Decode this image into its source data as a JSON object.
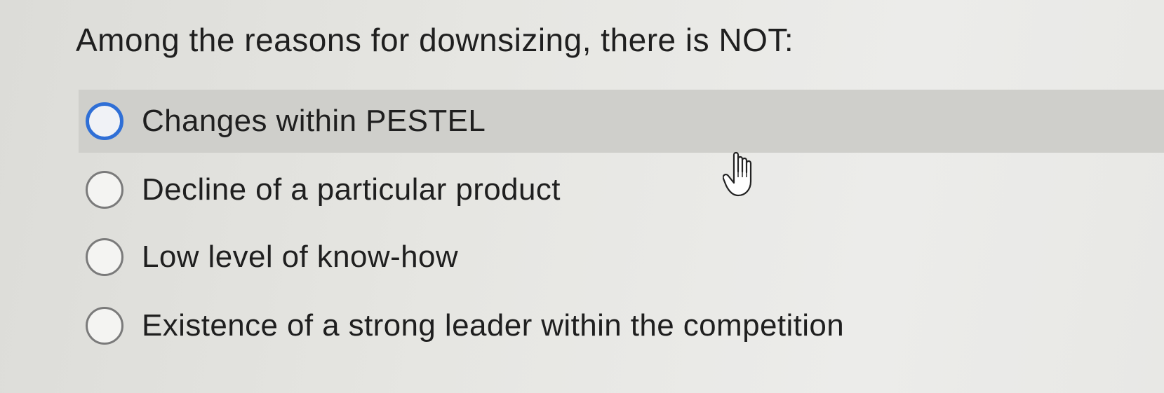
{
  "question": {
    "text": "Among the reasons for downsizing, there is NOT:"
  },
  "options": [
    {
      "label": "Changes within PESTEL",
      "highlighted": true
    },
    {
      "label": "Decline of a particular product",
      "highlighted": false
    },
    {
      "label": "Low level of know-how",
      "highlighted": false
    },
    {
      "label": "Existence of a strong leader within the competition",
      "highlighted": false
    }
  ],
  "colors": {
    "accent": "#2f6fd6",
    "highlight_row": "#cfcfcb",
    "radio_border": "#7a7a7a",
    "text": "#1f1f1f"
  },
  "cursor": {
    "icon": "hand-pointer-icon"
  }
}
